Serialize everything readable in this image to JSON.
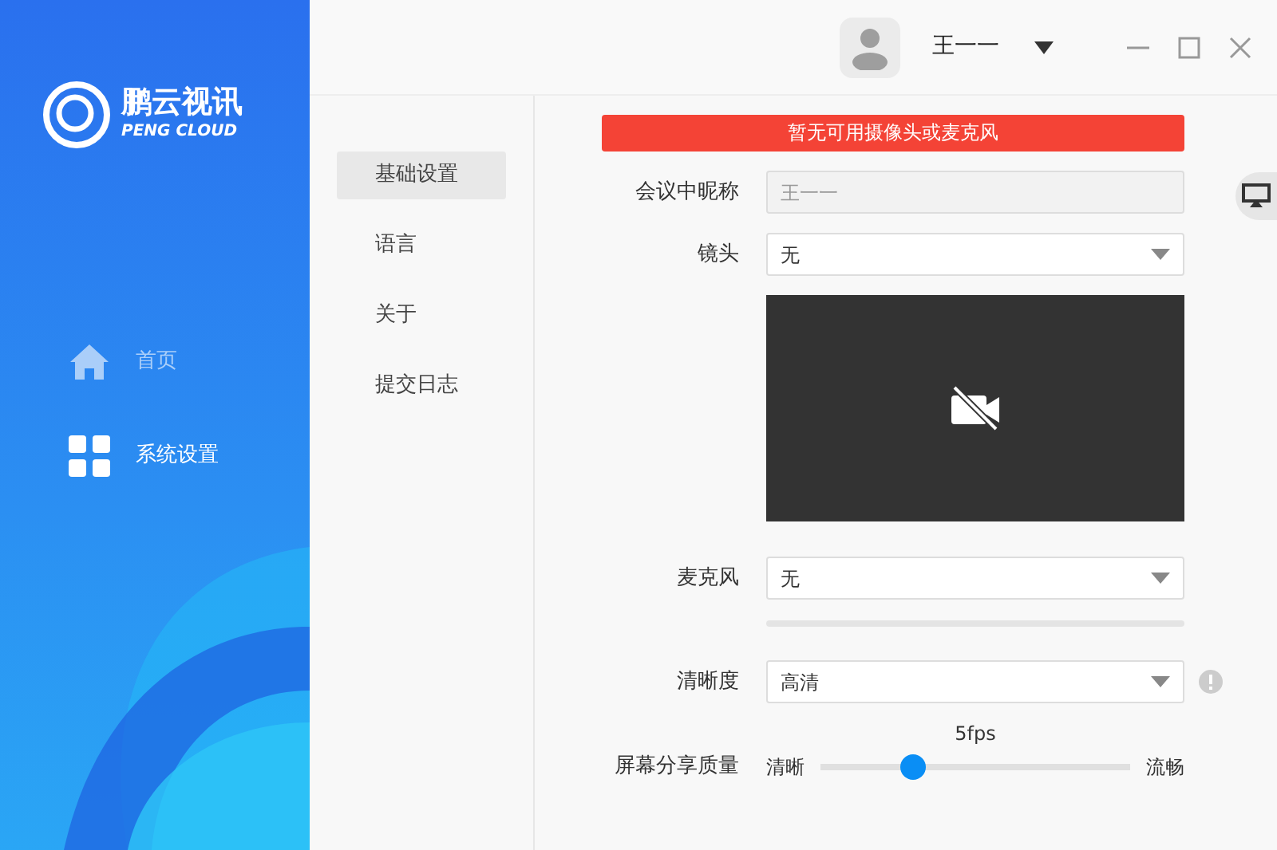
{
  "app": {
    "name": "鹏云视讯",
    "subtitle": "PENG CLOUD"
  },
  "sidebar": {
    "items": [
      {
        "label": "首页",
        "kind": "home",
        "selected": false
      },
      {
        "label": "系统设置",
        "kind": "grid",
        "selected": true
      }
    ]
  },
  "header": {
    "user_name": "王一一"
  },
  "settings_menu": [
    {
      "label": "基础设置",
      "selected": true
    },
    {
      "label": "语言",
      "selected": false
    },
    {
      "label": "关于",
      "selected": false
    },
    {
      "label": "提交日志",
      "selected": false
    }
  ],
  "alert": "暂无可用摄像头或麦克风",
  "form": {
    "nickname": {
      "label": "会议中昵称",
      "value": "王一一",
      "disabled": true
    },
    "camera": {
      "label": "镜头",
      "value": "无",
      "preview_off": true
    },
    "microphone": {
      "label": "麦克风",
      "value": "无"
    },
    "resolution": {
      "label": "清晰度",
      "value": "高清"
    },
    "share_quality": {
      "label": "屏幕分享质量",
      "reading": "5fps",
      "min_label": "清晰",
      "max_label": "流畅",
      "level": 0.3
    }
  }
}
